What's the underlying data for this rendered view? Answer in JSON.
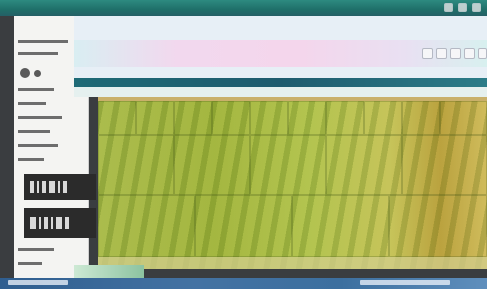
{
  "window": {
    "controls": [
      "minimize-icon",
      "maximize-icon",
      "close-icon"
    ]
  },
  "left_panel": {
    "widgets": [
      "nav-icon",
      "barcode-icon",
      "barcode-icon"
    ]
  },
  "toolbar": {
    "icons": [
      "tool-icon",
      "tool-icon",
      "tool-icon",
      "tool-icon",
      "tool-icon"
    ]
  },
  "canvas": {
    "content": "image-thumbnail-grid"
  },
  "colors": {
    "titlebar": "#1f6f69",
    "toolbar_bg": "#e7eff6",
    "band": "#1e6a76",
    "status": "#3c6f9f",
    "canvas": "#a6b84a"
  }
}
